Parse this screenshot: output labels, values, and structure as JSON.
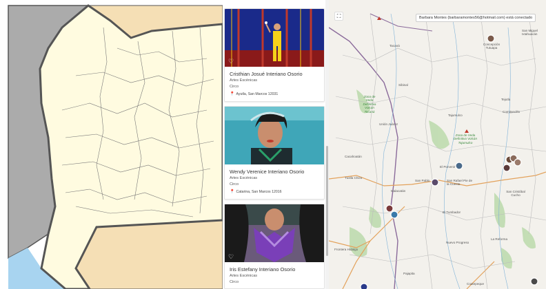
{
  "artists": [
    {
      "name": "Cristhian Josué Interiano Osorio",
      "discipline": "Artes Escénicas",
      "category": "Circo",
      "location": "Ayutla, San Marcos 12031"
    },
    {
      "name": "Wendy Verenice Interiano Osorio",
      "discipline": "Artes Escénicas",
      "category": "Circo",
      "location": "Catarina, San Marcos 12016"
    },
    {
      "name": "Iris Estefany Interiano Osorio",
      "discipline": "Artes Escénicas",
      "category": "Circo",
      "location": ""
    }
  ],
  "status": {
    "connected_text": "Barbara Montes (barbaramontes56@hotmail.com) está conectado"
  },
  "map": {
    "places": [
      {
        "label": "Tacaná"
      },
      {
        "label": "Sibinal"
      },
      {
        "label": "Tajumulco"
      },
      {
        "label": "Unión Juárez"
      },
      {
        "label": "Cacahoatán"
      },
      {
        "label": "Tuxtla Chico"
      },
      {
        "label": "Malacatán"
      },
      {
        "label": "San Pablo"
      },
      {
        "label": "El Tumbador"
      },
      {
        "label": "Nuevo Progreso"
      },
      {
        "label": "La Reforma"
      },
      {
        "label": "Coatepeque"
      },
      {
        "label": "San Rafael Pie de la Cuesta"
      },
      {
        "label": "El Porvenir"
      },
      {
        "label": "Tejutla"
      },
      {
        "label": "Comitancillo"
      },
      {
        "label": "San Miguel Ixtahuacán"
      },
      {
        "label": "Concepción Tutuapa"
      },
      {
        "label": "San Cristóbal Cucho"
      },
      {
        "label": "Frontera Hidalgo"
      },
      {
        "label": "Pajapita"
      },
      {
        "label": "Zona de Veda Definitiva Volcán Tajumulco"
      },
      {
        "label": "Zona de Veda Definitiva Volcán Tacaná"
      }
    ]
  },
  "icons": {
    "expand": "expand-icon",
    "heart": "heart-icon",
    "pin": "location-pin-icon"
  },
  "colors": {
    "land": "#fffbe0",
    "neighbor": "#f5dfb5",
    "water": "#a8d4f0",
    "gray_region": "#ababab",
    "border": "#555555"
  }
}
